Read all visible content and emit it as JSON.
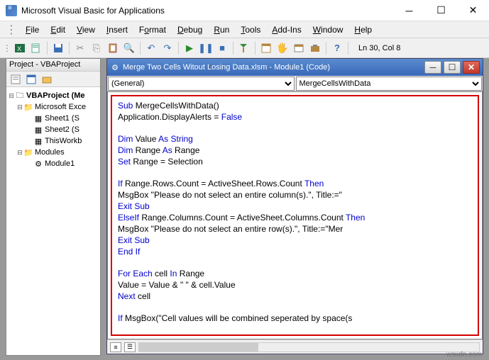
{
  "title": "Microsoft Visual Basic for Applications",
  "menu": {
    "file": "File",
    "edit": "Edit",
    "view": "View",
    "insert": "Insert",
    "format": "Format",
    "debug": "Debug",
    "run": "Run",
    "tools": "Tools",
    "addins": "Add-Ins",
    "window": "Window",
    "help": "Help"
  },
  "status": "Ln 30, Col 8",
  "proj": {
    "title": "Project - VBAProject",
    "root": "VBAProject (Me",
    "excel": "Microsoft Exce",
    "sheet1": "Sheet1 (S",
    "sheet2": "Sheet2 (S",
    "thiswb": "ThisWorkb",
    "modules": "Modules",
    "module1": "Module1"
  },
  "codewin": {
    "title": "Merge Two Cells Witout Losing Data.xlsm - Module1 (Code)",
    "drop1": "(General)",
    "drop2": "MergeCellsWithData"
  },
  "code": {
    "l1a": "Sub",
    "l1b": " MergeCellsWithData()",
    "l2a": "Application.DisplayAlerts = ",
    "l2b": "False",
    "l4a": "Dim",
    "l4b": " Value ",
    "l4c": "As String",
    "l5a": "Dim",
    "l5b": " Range ",
    "l5c": "As",
    "l5d": " Range",
    "l6a": "Set",
    "l6b": " Range = Selection",
    "l8a": "If",
    "l8b": " Range.Rows.Count = ActiveSheet.Rows.Count ",
    "l8c": "Then",
    "l9": "MsgBox \"Please do not select an entire column(s).\", Title:=\"",
    "l10": "Exit Sub",
    "l11a": "ElseIf",
    "l11b": " Range.Columns.Count = ActiveSheet.Columns.Count ",
    "l11c": "Then",
    "l12": "MsgBox \"Please do not select an entire row(s).\", Title:=\"Mer",
    "l13": "Exit Sub",
    "l14": "End If",
    "l16a": "For Each",
    "l16b": " cell ",
    "l16c": "In",
    "l16d": " Range",
    "l17": "Value = Value & \" \" & cell.Value",
    "l18a": "Next",
    "l18b": " cell",
    "l20a": "If",
    "l20b": " MsgBox(\"Cell values will be combined seperated by space(s"
  },
  "watermark": "wsxdn.com"
}
